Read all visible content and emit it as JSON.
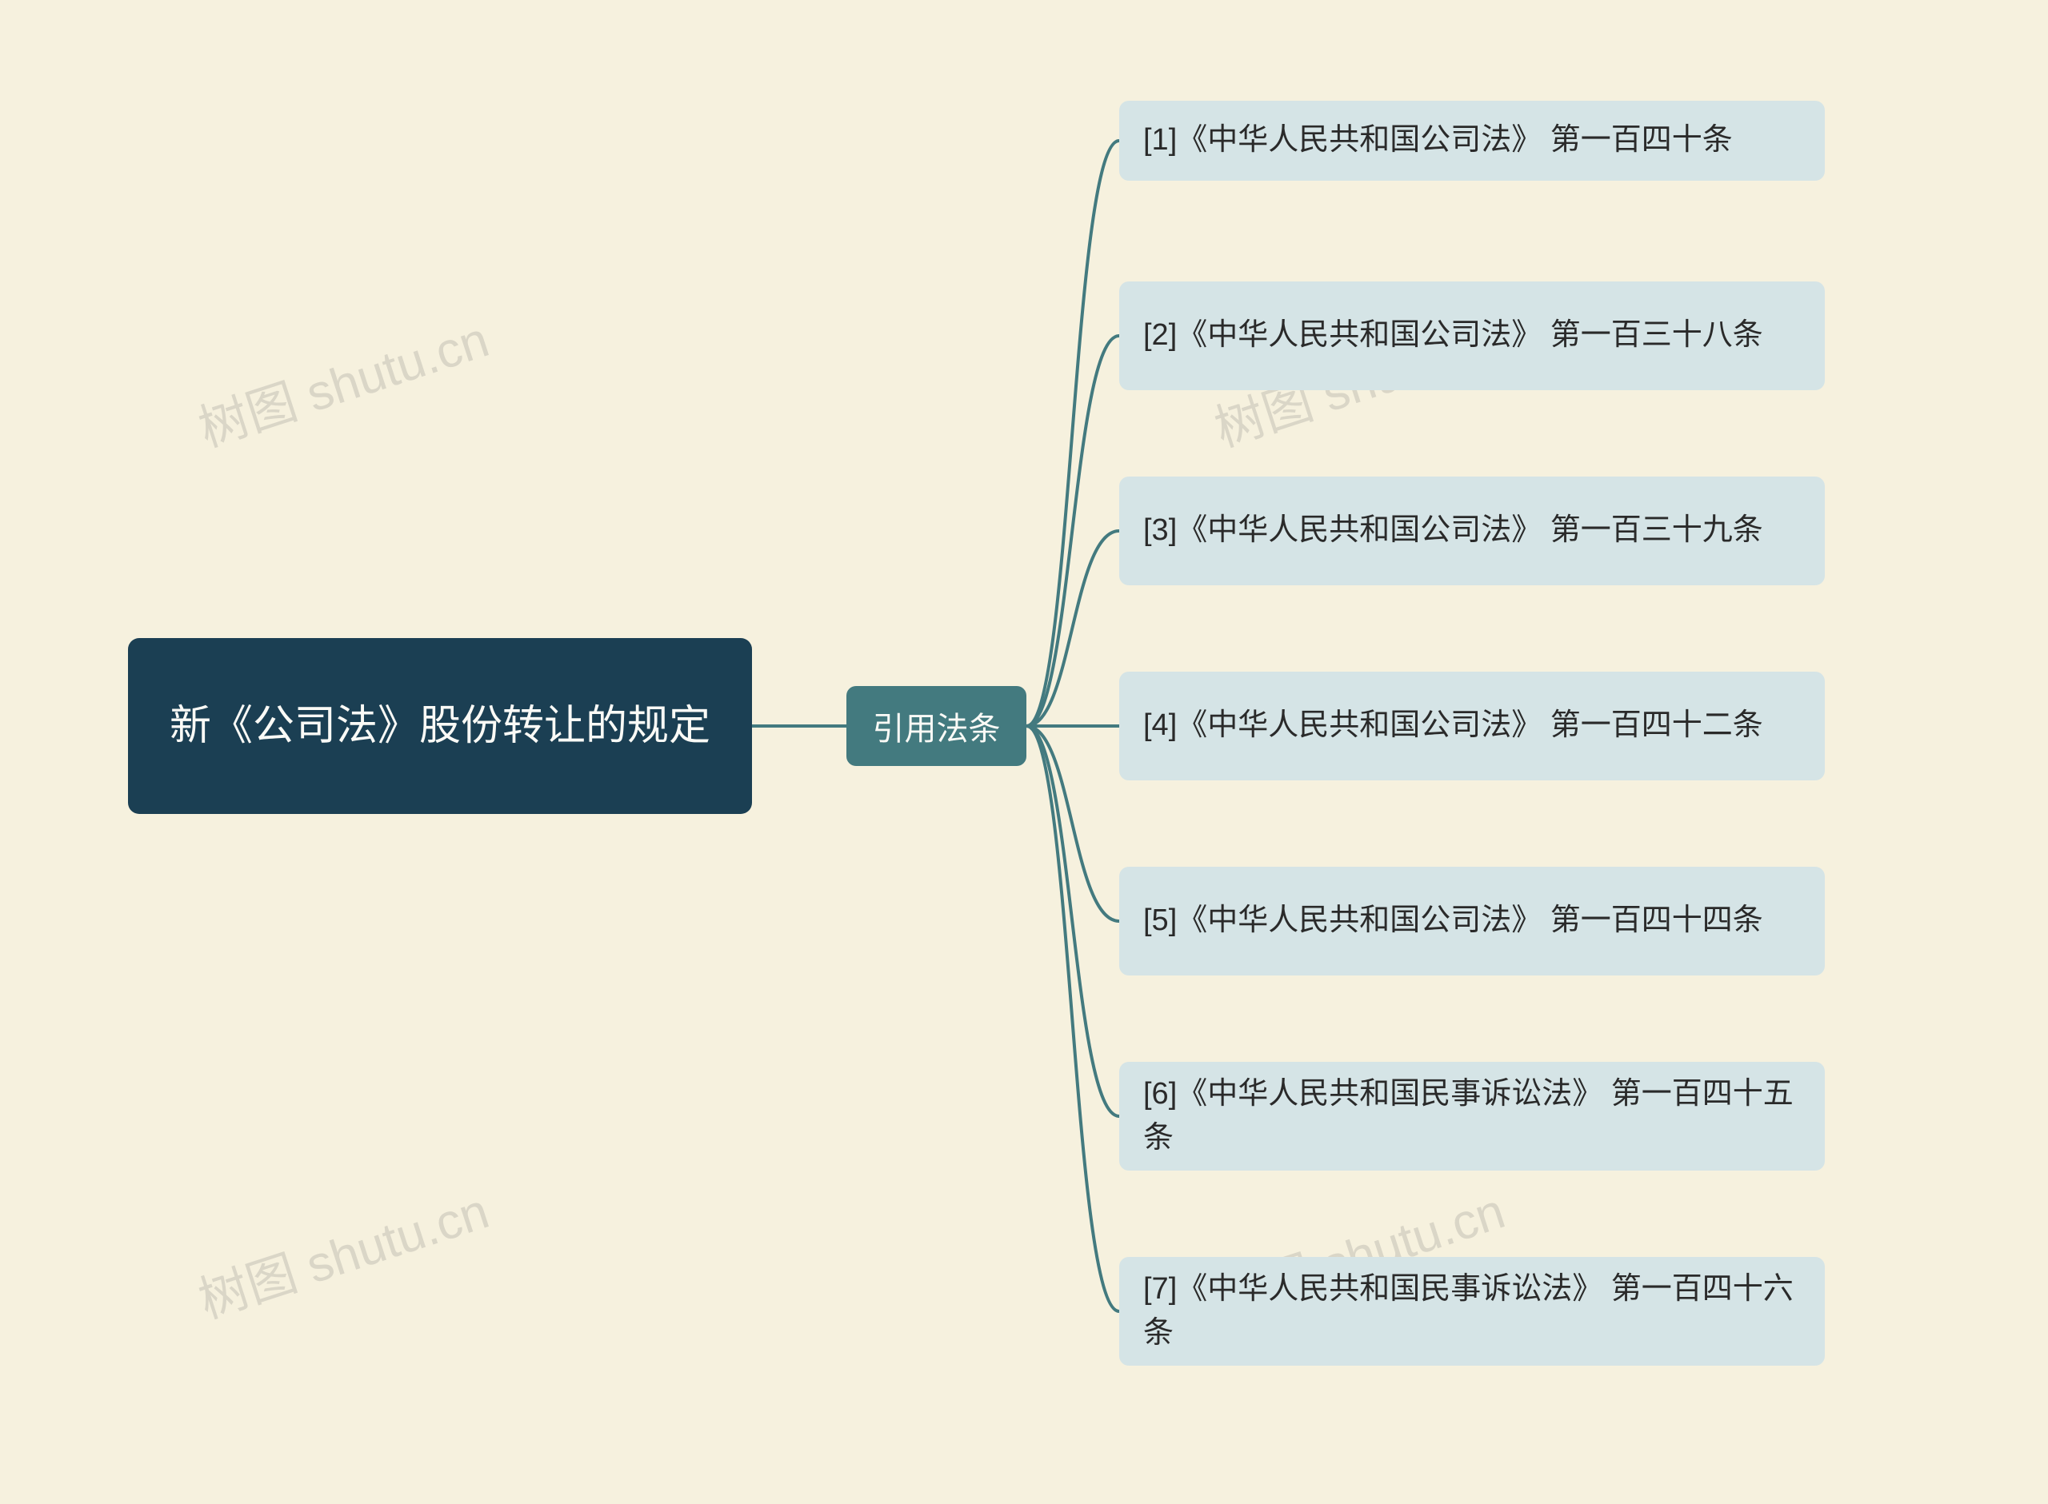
{
  "root": {
    "title": "新《公司法》股份转让的规定"
  },
  "branch": {
    "label": "引用法条"
  },
  "leaves": [
    {
      "text": "[1]《中华人民共和国公司法》 第一百四十条"
    },
    {
      "text": "[2]《中华人民共和国公司法》 第一百三十八条"
    },
    {
      "text": "[3]《中华人民共和国公司法》 第一百三十九条"
    },
    {
      "text": "[4]《中华人民共和国公司法》 第一百四十二条"
    },
    {
      "text": "[5]《中华人民共和国公司法》 第一百四十四条"
    },
    {
      "text": "[6]《中华人民共和国民事诉讼法》 第一百四十五条"
    },
    {
      "text": "[7]《中华人民共和国民事诉讼法》 第一百四十六条"
    }
  ],
  "watermark": {
    "text": "树图 shutu.cn"
  },
  "colors": {
    "background": "#f6f1de",
    "root_bg": "#1b3f53",
    "branch_bg": "#437a7f",
    "leaf_bg": "#d5e4e6",
    "connector": "#437a7f"
  }
}
